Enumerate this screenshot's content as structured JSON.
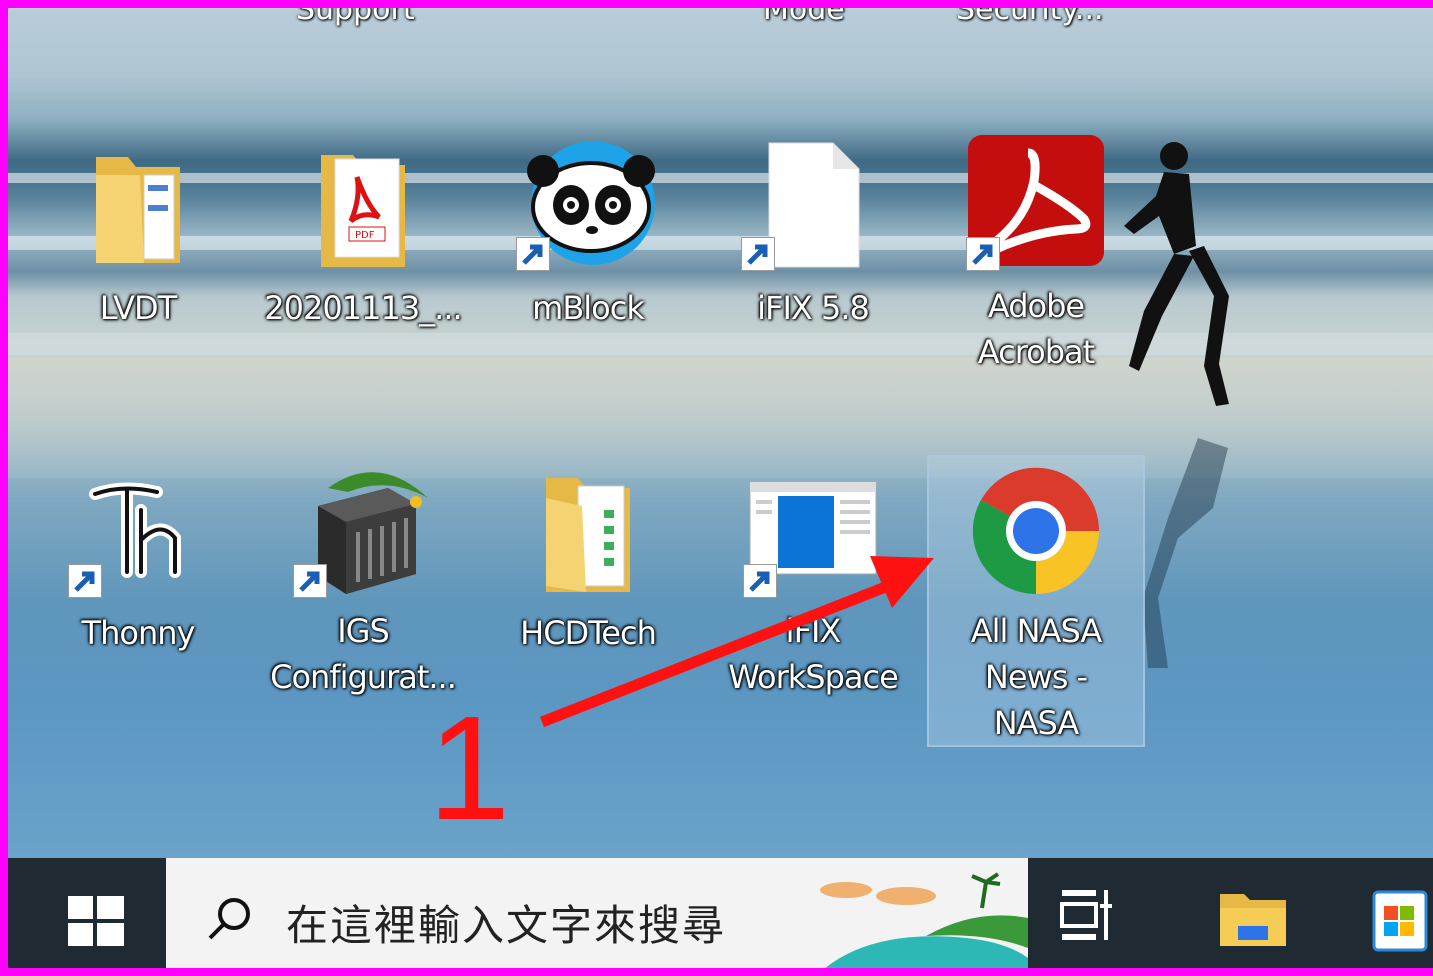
{
  "colors": {
    "frame": "#ff00ff",
    "annotation": "#ff1111",
    "taskbar": "#1f2a33",
    "search_bg": "#f3f3f3"
  },
  "top_row_partial": [
    {
      "label": "Support"
    },
    {
      "label": "Mode"
    },
    {
      "label": "Security..."
    }
  ],
  "desktop_icons": [
    {
      "label_lines": [
        "LVDT"
      ],
      "icon": "folder-icon",
      "shortcut": false
    },
    {
      "label_lines": [
        "20201113_..."
      ],
      "icon": "pdf-file-icon",
      "shortcut": false
    },
    {
      "label_lines": [
        "mBlock"
      ],
      "icon": "mblock-panda-icon",
      "shortcut": true
    },
    {
      "label_lines": [
        "iFIX 5.8"
      ],
      "icon": "blank-file-icon",
      "shortcut": true
    },
    {
      "label_lines": [
        "Adobe",
        "Acrobat"
      ],
      "icon": "adobe-acrobat-icon",
      "shortcut": true
    },
    {
      "label_lines": [
        "Thonny"
      ],
      "icon": "thonny-icon",
      "shortcut": true
    },
    {
      "label_lines": [
        "IGS",
        "Configurat..."
      ],
      "icon": "igs-server-icon",
      "shortcut": true
    },
    {
      "label_lines": [
        "HCDTech"
      ],
      "icon": "folder-icon",
      "shortcut": false
    },
    {
      "label_lines": [
        "iFIX",
        "WorkSpace"
      ],
      "icon": "ifix-workspace-icon",
      "shortcut": true
    },
    {
      "label_lines": [
        "All NASA",
        "News -",
        "NASA"
      ],
      "icon": "chrome-icon",
      "shortcut": false,
      "selected": true
    }
  ],
  "annotation": {
    "step_number": "1"
  },
  "taskbar": {
    "start_icon": "windows-logo-icon",
    "search_placeholder": "在這裡輸入文字來搜尋",
    "search_icon": "search-icon",
    "task_view_icon": "task-view-icon",
    "pinned": [
      {
        "icon": "file-explorer-icon",
        "active": true
      },
      {
        "icon": "microsoft-store-icon",
        "active": false
      }
    ]
  }
}
